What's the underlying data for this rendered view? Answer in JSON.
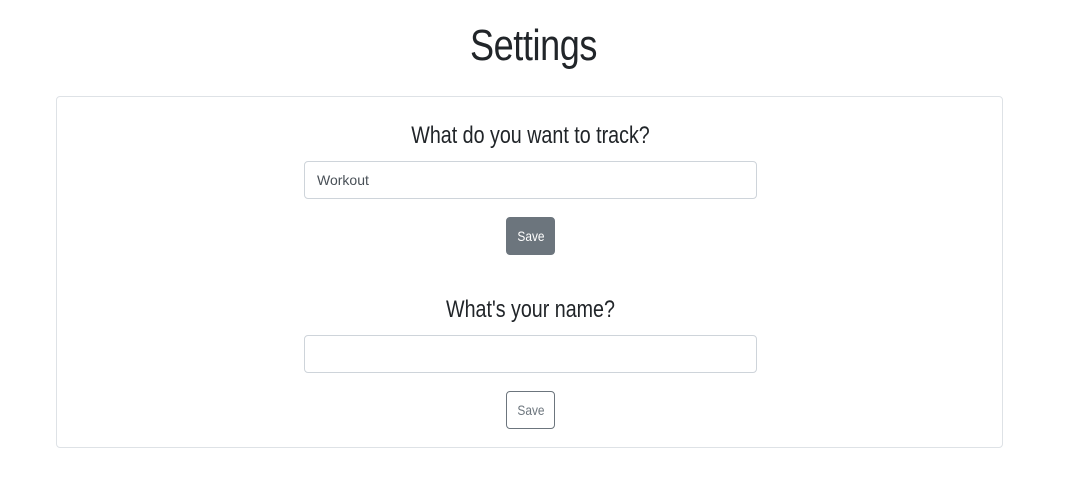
{
  "page": {
    "title": "Settings"
  },
  "track_section": {
    "heading": "What do you want to track?",
    "input_value": "Workout",
    "input_placeholder": "",
    "save_label": "Save"
  },
  "name_section": {
    "heading": "What's your name?",
    "input_value": "",
    "input_placeholder": "",
    "save_label": "Save"
  },
  "colors": {
    "primary_button": "#6c757d",
    "border": "#dee2e6",
    "text": "#212529"
  }
}
